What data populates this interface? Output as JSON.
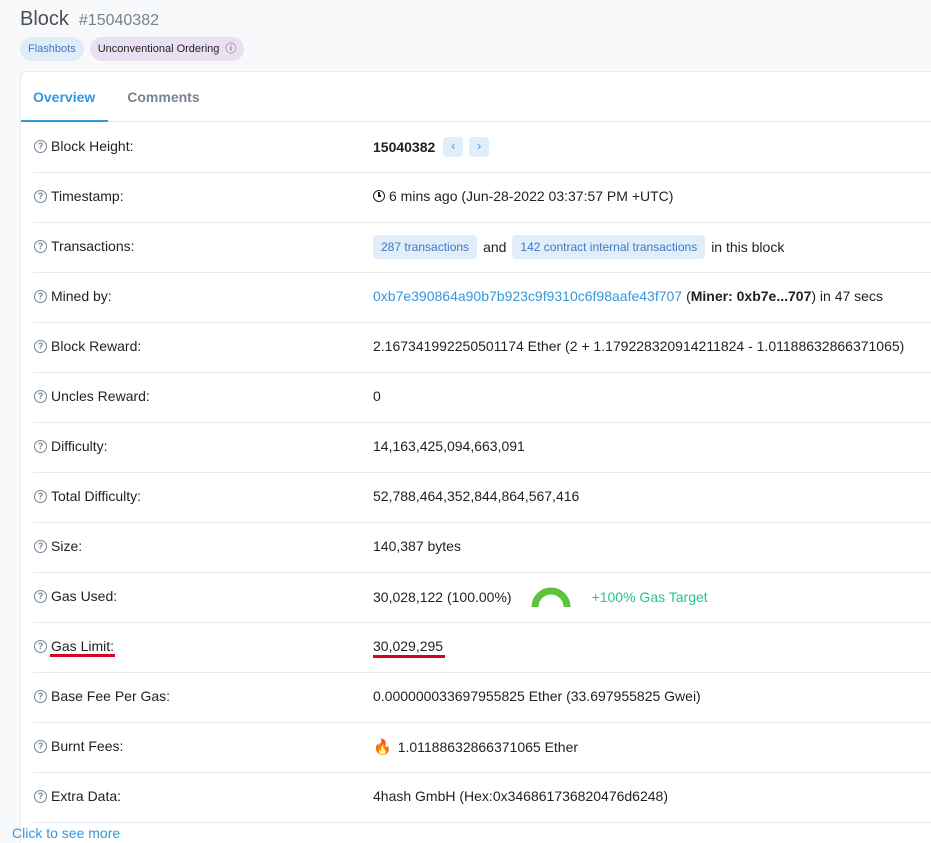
{
  "header": {
    "title": "Block",
    "block_number": "#15040382",
    "badges": {
      "flashbots": "Flashbots",
      "unconventional": "Unconventional Ordering"
    }
  },
  "tabs": {
    "overview": "Overview",
    "comments": "Comments"
  },
  "rows": {
    "block_height": {
      "label": "Block Height:",
      "value": "15040382"
    },
    "timestamp": {
      "label": "Timestamp:",
      "value": "6 mins ago (Jun-28-2022 03:37:57 PM +UTC)"
    },
    "transactions": {
      "label": "Transactions:",
      "tx_pill": "287 transactions",
      "and": "and",
      "internal_pill": "142 contract internal transactions",
      "suffix": "in this block"
    },
    "mined_by": {
      "label": "Mined by:",
      "address": "0xb7e390864a90b7b923c9f9310c6f98aafe43f707",
      "open_paren": "(",
      "miner": "Miner: 0xb7e...707",
      "suffix": ") in 47 secs"
    },
    "block_reward": {
      "label": "Block Reward:",
      "value": "2.167341992250501174 Ether (2 + 1.179228320914211824 - 1.01188632866371065)"
    },
    "uncles_reward": {
      "label": "Uncles Reward:",
      "value": "0"
    },
    "difficulty": {
      "label": "Difficulty:",
      "value": "14,163,425,094,663,091"
    },
    "total_difficulty": {
      "label": "Total Difficulty:",
      "value": "52,788,464,352,844,864,567,416"
    },
    "size": {
      "label": "Size:",
      "value": "140,387 bytes"
    },
    "gas_used": {
      "label": "Gas Used:",
      "value": "30,028,122 (100.00%)",
      "target": "+100% Gas Target",
      "gauge_fraction": 1.0,
      "gauge_color": "#5cc33c"
    },
    "gas_limit": {
      "label": "Gas Limit:",
      "value": "30,029,295"
    },
    "base_fee": {
      "label": "Base Fee Per Gas:",
      "value": "0.000000033697955825 Ether (33.697955825 Gwei)"
    },
    "burnt_fees": {
      "label": "Burnt Fees:",
      "value": "1.01188632866371065 Ether",
      "icon": "fire-icon"
    },
    "extra_data": {
      "label": "Extra Data:",
      "value": "4hash GmbH (Hex:0x346861736820476d6248)"
    }
  },
  "footer": {
    "link": "Click to see more"
  },
  "colors": {
    "accent": "#3498db",
    "highlight_underline": "#d6051e",
    "positive": "#1ec98a"
  }
}
